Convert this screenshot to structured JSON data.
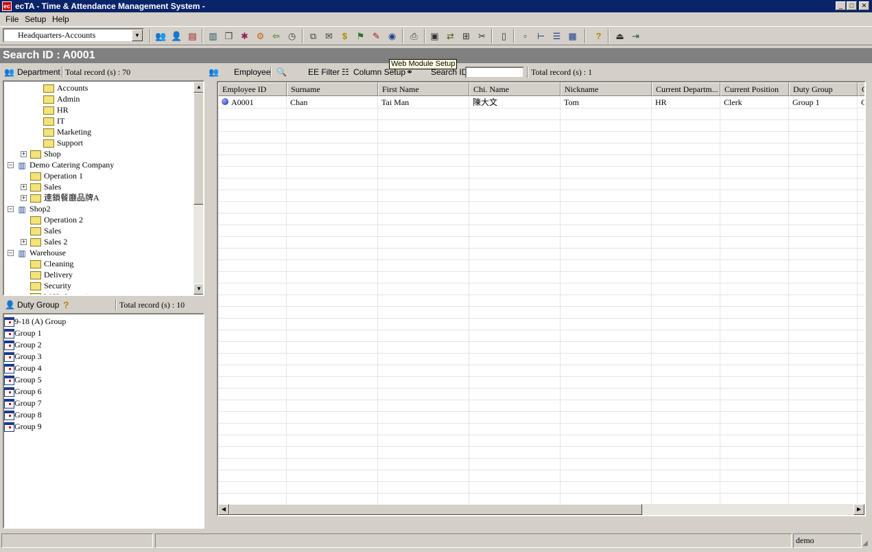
{
  "window": {
    "title": "ecTA - Time & Attendance Management System -",
    "app_icon": "ec"
  },
  "menu": [
    "File",
    "Setup",
    "Help"
  ],
  "toolbar": {
    "dept_selected": "Headquarters-Accounts",
    "tooltip": "Web Module Setup"
  },
  "search": {
    "title": "Search ID : A0001"
  },
  "department_panel": {
    "label": "Department",
    "total": "Total record (s) : 70",
    "tree": [
      {
        "label": "Accounts",
        "icon": "folder"
      },
      {
        "label": "Admin",
        "icon": "folder"
      },
      {
        "label": "HR",
        "icon": "folder"
      },
      {
        "label": "IT",
        "icon": "folder"
      },
      {
        "label": "Marketing",
        "icon": "folder"
      },
      {
        "label": "Support",
        "icon": "folder"
      },
      {
        "label": "Shop",
        "icon": "folder",
        "expander": "+"
      },
      {
        "label": "Demo Catering Company",
        "icon": "building",
        "expander": "-"
      },
      {
        "label": "Operation 1",
        "icon": "folder"
      },
      {
        "label": "Sales",
        "icon": "folder",
        "expander": "+"
      },
      {
        "label": "連鎖餐廳品牌A",
        "icon": "folder",
        "expander": "+"
      },
      {
        "label": "Shop2",
        "icon": "building",
        "expander": "-"
      },
      {
        "label": "Operation 2",
        "icon": "folder"
      },
      {
        "label": "Sales",
        "icon": "folder"
      },
      {
        "label": "Sales 2",
        "icon": "folder",
        "expander": "+"
      },
      {
        "label": "Warehouse",
        "icon": "building",
        "expander": "-"
      },
      {
        "label": "Cleaning",
        "icon": "folder"
      },
      {
        "label": "Delivery",
        "icon": "folder"
      },
      {
        "label": "Security",
        "icon": "folder"
      },
      {
        "label": "W.H. Operation",
        "icon": "folder"
      }
    ]
  },
  "duty_panel": {
    "label": "Duty Group",
    "total": "Total record (s) : 10",
    "groups": [
      "9-18 (A) Group",
      "Group 1",
      "Group 2",
      "Group 3",
      "Group 4",
      "Group 5",
      "Group 6",
      "Group 7",
      "Group 8",
      "Group 9"
    ]
  },
  "employee_panel": {
    "label": "Employee",
    "filter_label": "EE Filter",
    "column_setup_label": "Column Setup",
    "search_id_label": "Search ID",
    "search_id_value": "",
    "total": "Total record (s) : 1",
    "columns": [
      "Employee ID",
      "Surname",
      "First Name",
      "Chi. Name",
      "Nickname",
      "Current Departm...",
      "Current Position",
      "Duty Group",
      "G"
    ],
    "rows": [
      [
        "A0001",
        "Chan",
        "Tai Man",
        "陳大文",
        "Tom",
        "HR",
        "Clerk",
        "Group 1",
        "G"
      ]
    ]
  },
  "status": {
    "user": "demo"
  },
  "colors": {
    "titlebar": "#0a246a",
    "search_header": "#808080",
    "face": "#d4d0c8"
  }
}
